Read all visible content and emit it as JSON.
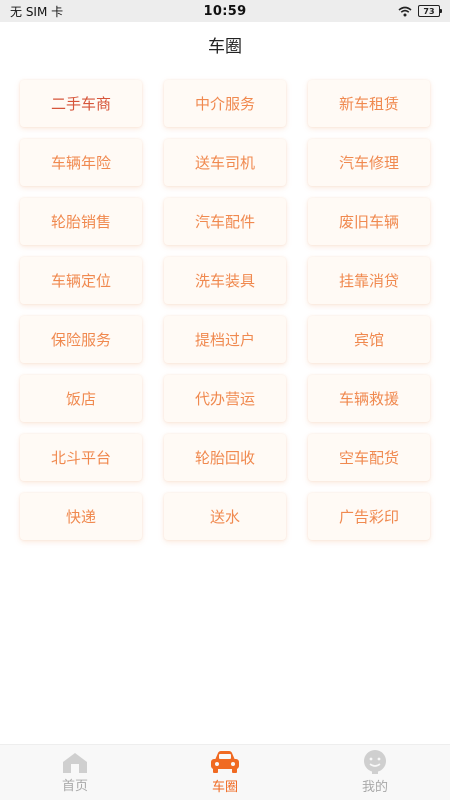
{
  "status_bar": {
    "carrier": "无 SIM 卡",
    "time": "10:59",
    "battery": "73"
  },
  "header": {
    "title": "车圈"
  },
  "grid_items": [
    "二手车商",
    "中介服务",
    "新车租赁",
    "车辆年险",
    "送车司机",
    "汽车修理",
    "轮胎销售",
    "汽车配件",
    "废旧车辆",
    "车辆定位",
    "洗车装具",
    "挂靠消贷",
    "保险服务",
    "提档过户",
    "宾馆",
    "饭店",
    "代办营运",
    "车辆救援",
    "北斗平台",
    "轮胎回收",
    "空车配货",
    "快递",
    "送水",
    "广告彩印"
  ],
  "tab_bar": {
    "items": [
      {
        "label": "首页",
        "icon": "home-icon",
        "active": false
      },
      {
        "label": "车圈",
        "icon": "car-icon",
        "active": true
      },
      {
        "label": "我的",
        "icon": "profile-icon",
        "active": false
      }
    ]
  },
  "colors": {
    "accent": "#f06a22",
    "tile_text": "#f0894f",
    "tile_bg": "#fffaf5",
    "inactive": "#a9a9a9"
  }
}
